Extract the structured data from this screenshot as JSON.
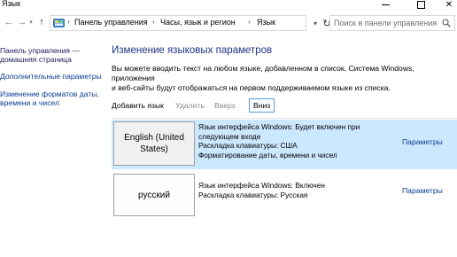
{
  "window": {
    "title": "Язык"
  },
  "address": {
    "breadcrumbs": [
      "Панель управления",
      "Часы, язык и регион",
      "Язык"
    ],
    "search_placeholder": "Поиск в панели управления"
  },
  "left_pane": {
    "home_link": [
      "Панель управления —",
      "домашняя страница"
    ],
    "advanced_link": "Дополнительные параметры",
    "formats_link": [
      "Изменение форматов даты,",
      "времени и чисел"
    ]
  },
  "main": {
    "title": "Изменение языковых параметров",
    "description": [
      "Вы можете вводить текст на любом языке, добавленном в список. Система Windows, приложения",
      "и веб-сайты будут отображаться на первом поддерживаемом языке из списка."
    ],
    "toolbar": {
      "add": "Добавить язык",
      "remove": "Удалить",
      "up": "Вверх",
      "down": "Вниз"
    },
    "languages": [
      {
        "name": "English (United States)",
        "details": [
          "Язык интерфейса Windows: Будет включен при",
          "следующем входе",
          "Раскладка клавиатуры: США",
          "Форматирование даты, времени и чисел"
        ],
        "settings": "Параметры",
        "selected": true
      },
      {
        "name": "русский",
        "details": [
          "Язык интерфейса Windows: Включен",
          "Раскладка клавиатуры: Русская"
        ],
        "settings": "Параметры",
        "selected": false
      }
    ]
  },
  "colors": {
    "selection": "#cce8ff",
    "link": "#0b3d91",
    "title": "#1e3287",
    "focus_border": "#5b9bd5"
  },
  "icons": [
    "minimize-icon",
    "maximize-icon",
    "close-icon",
    "back-arrow-icon",
    "forward-arrow-icon",
    "up-arrow-icon",
    "control-panel-icon",
    "search-icon",
    "refresh-icon"
  ]
}
